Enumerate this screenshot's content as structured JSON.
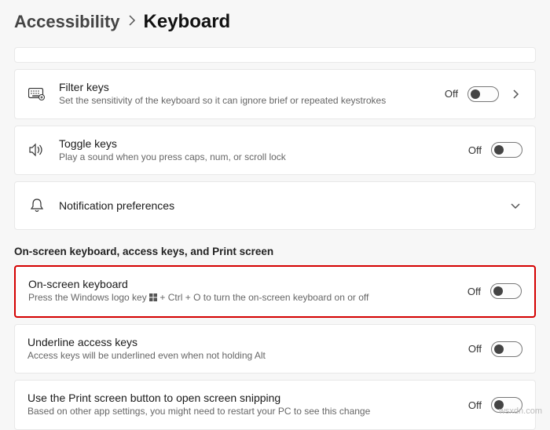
{
  "breadcrumb": {
    "parent": "Accessibility",
    "current": "Keyboard"
  },
  "states": {
    "off": "Off"
  },
  "rows": {
    "filter_keys": {
      "title": "Filter keys",
      "desc": "Set the sensitivity of the keyboard so it can ignore brief or repeated keystrokes",
      "state": "Off"
    },
    "toggle_keys": {
      "title": "Toggle keys",
      "desc": "Play a sound when you press caps, num, or scroll lock",
      "state": "Off"
    },
    "notification_prefs": {
      "title": "Notification preferences"
    },
    "osk": {
      "title": "On-screen keyboard",
      "desc_before": "Press the Windows logo key ",
      "desc_after": " + Ctrl + O to turn the on-screen keyboard on or off",
      "state": "Off"
    },
    "underline": {
      "title": "Underline access keys",
      "desc": "Access keys will be underlined even when not holding Alt",
      "state": "Off"
    },
    "printscreen": {
      "title": "Use the Print screen button to open screen snipping",
      "desc": "Based on other app settings, you might need to restart your PC to see this change",
      "state": "Off"
    }
  },
  "section_label": "On-screen keyboard, access keys, and Print screen",
  "watermark": "wsxdn.com"
}
